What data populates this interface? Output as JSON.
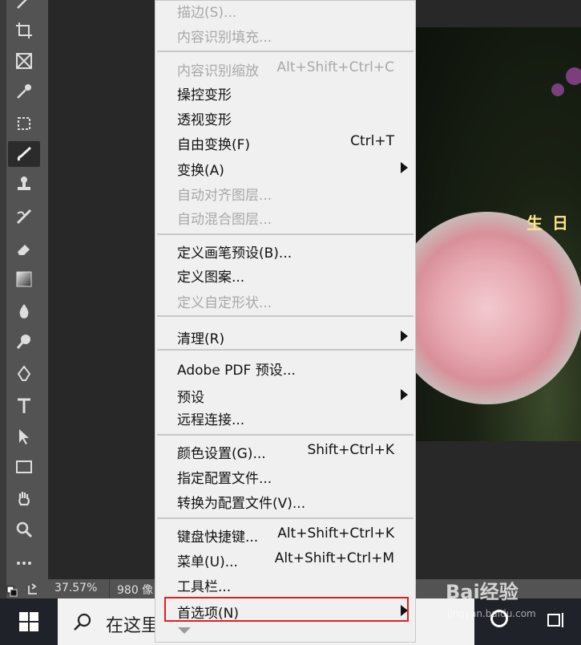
{
  "status": {
    "zoom": "37.57%",
    "doc_info": "980 像"
  },
  "photo": {
    "caption": "生日"
  },
  "taskbar": {
    "search_placeholder": "在这里"
  },
  "watermark": {
    "logo": "Bai经验",
    "url": "jingyan.baidu.com"
  },
  "colors": {
    "menu_bg": "#f0f0f0",
    "disabled_text": "#a8a8a8",
    "highlight": "#e02020",
    "toolbar": "#535353"
  },
  "menu": {
    "items": [
      {
        "label": "描边(S)...",
        "shortcut": "",
        "disabled": true,
        "submenu": false
      },
      {
        "label": "内容识别填充...",
        "shortcut": "",
        "disabled": true,
        "submenu": false
      },
      {
        "label": "内容识别缩放",
        "shortcut": "Alt+Shift+Ctrl+C",
        "disabled": true,
        "submenu": false
      },
      {
        "label": "操控变形",
        "shortcut": "",
        "disabled": false,
        "submenu": false
      },
      {
        "label": "透视变形",
        "shortcut": "",
        "disabled": false,
        "submenu": false
      },
      {
        "label": "自由变换(F)",
        "shortcut": "Ctrl+T",
        "disabled": false,
        "submenu": false
      },
      {
        "label": "变换(A)",
        "shortcut": "",
        "disabled": false,
        "submenu": true
      },
      {
        "label": "自动对齐图层...",
        "shortcut": "",
        "disabled": true,
        "submenu": false
      },
      {
        "label": "自动混合图层...",
        "shortcut": "",
        "disabled": true,
        "submenu": false
      },
      {
        "label": "定义画笔预设(B)...",
        "shortcut": "",
        "disabled": false,
        "submenu": false
      },
      {
        "label": "定义图案...",
        "shortcut": "",
        "disabled": false,
        "submenu": false
      },
      {
        "label": "定义自定形状...",
        "shortcut": "",
        "disabled": true,
        "submenu": false
      },
      {
        "label": "清理(R)",
        "shortcut": "",
        "disabled": false,
        "submenu": true
      },
      {
        "label": "Adobe PDF 预设...",
        "shortcut": "",
        "disabled": false,
        "submenu": false
      },
      {
        "label": "预设",
        "shortcut": "",
        "disabled": false,
        "submenu": true
      },
      {
        "label": "远程连接...",
        "shortcut": "",
        "disabled": false,
        "submenu": false
      },
      {
        "label": "颜色设置(G)...",
        "shortcut": "Shift+Ctrl+K",
        "disabled": false,
        "submenu": false
      },
      {
        "label": "指定配置文件...",
        "shortcut": "",
        "disabled": false,
        "submenu": false
      },
      {
        "label": "转换为配置文件(V)...",
        "shortcut": "",
        "disabled": false,
        "submenu": false
      },
      {
        "label": "键盘快捷键...",
        "shortcut": "Alt+Shift+Ctrl+K",
        "disabled": false,
        "submenu": false
      },
      {
        "label": "菜单(U)...",
        "shortcut": "Alt+Shift+Ctrl+M",
        "disabled": false,
        "submenu": false
      },
      {
        "label": "工具栏...",
        "shortcut": "",
        "disabled": false,
        "submenu": false
      },
      {
        "label": "首选项(N)",
        "shortcut": "",
        "disabled": false,
        "submenu": true
      }
    ]
  }
}
